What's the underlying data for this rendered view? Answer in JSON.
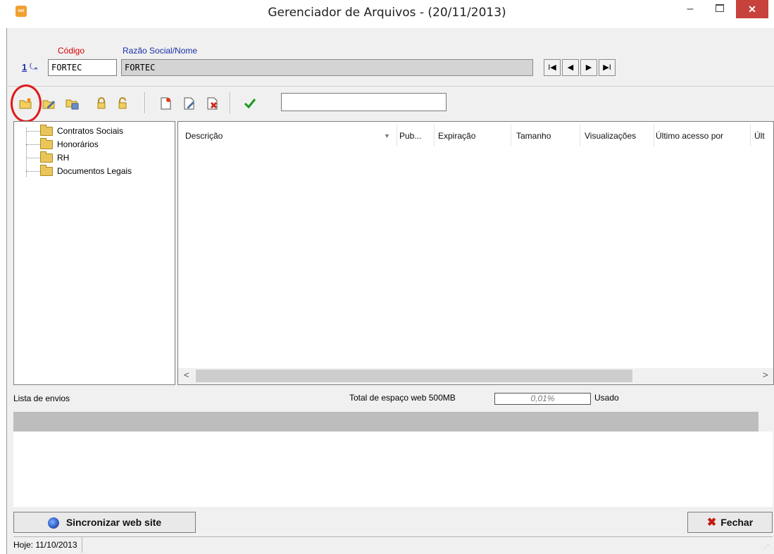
{
  "window": {
    "title": "Gerenciador de Arquivos - (20/11/2013)",
    "app_icon_text": "net",
    "minimize": "–",
    "close": "✕"
  },
  "header": {
    "codigo_label": "Código",
    "razao_label": "Razão Social/Nome",
    "index_number": "1",
    "codigo_value": "FORTEC",
    "razao_value": "FORTEC"
  },
  "navigation": {
    "first": "I◀",
    "prev": "◀",
    "next": "▶",
    "last": "▶I"
  },
  "toolbar": {
    "search_value": "",
    "icons": [
      "new-folder-icon",
      "edit-folder-icon",
      "delete-folder-icon",
      "lock-icon",
      "unlock-icon",
      "new-file-icon",
      "edit-file-icon",
      "delete-file-icon",
      "confirm-icon"
    ]
  },
  "tree": {
    "items": [
      {
        "label": "Contratos Sociais"
      },
      {
        "label": "Honorários"
      },
      {
        "label": "RH"
      },
      {
        "label": "Documentos Legais"
      }
    ]
  },
  "grid": {
    "columns": [
      "Descrição",
      "Pub...",
      "Expiração",
      "Tamanho",
      "Visualizações",
      "Último acesso por",
      "Últ"
    ],
    "sort_indicator": "▼",
    "scroll_left": "<",
    "scroll_right": ">"
  },
  "uploads": {
    "label": "Lista de envios",
    "space_label": "Total de espaço web 500MB",
    "usage_percent": "0,01%",
    "usage_suffix": "Usado"
  },
  "buttons": {
    "sync": "Sincronizar web site",
    "close_label": "Fechar"
  },
  "statusbar": {
    "today": "Hoje: 11/10/2013"
  },
  "colors": {
    "close_button": "#c7423c",
    "highlight_circle": "#e01b1b",
    "label_codigo": "#d40000",
    "label_razao": "#1a2fa8"
  }
}
